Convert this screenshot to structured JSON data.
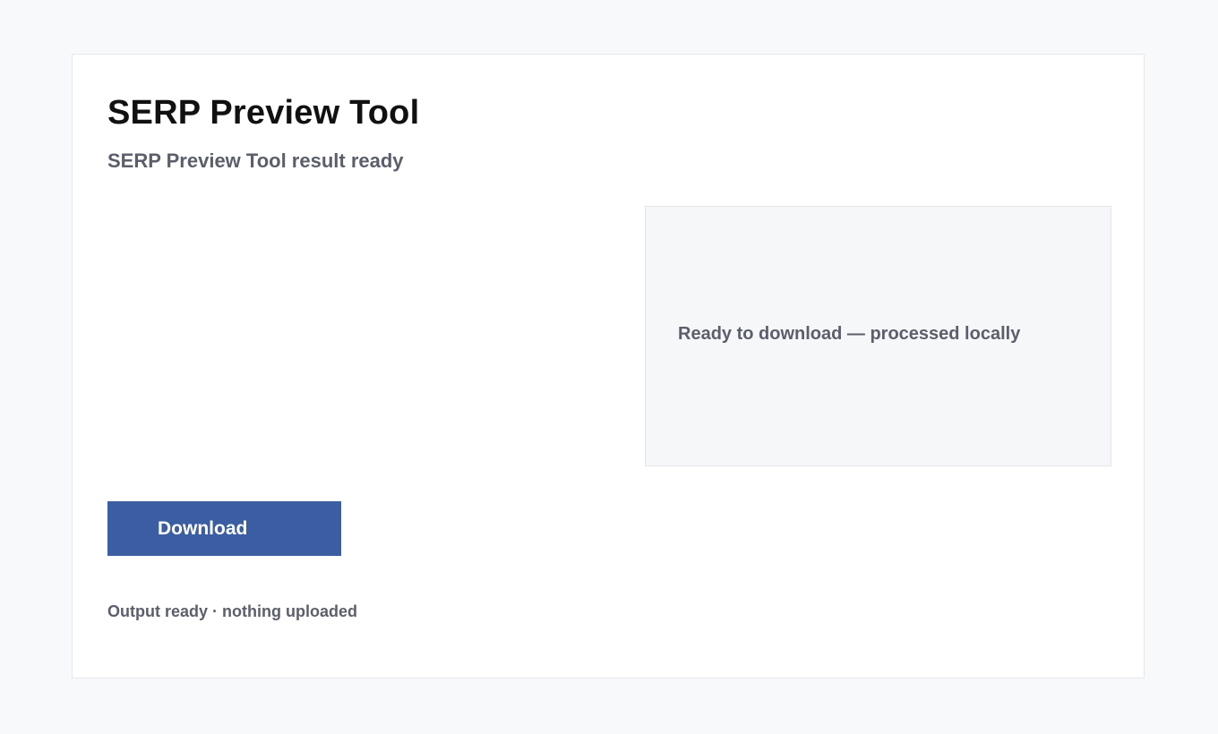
{
  "app": {
    "title": "SERP Preview Tool",
    "subtitle": "SERP Preview Tool result ready"
  },
  "result_panel": {
    "status": "Ready to download — processed locally"
  },
  "actions": {
    "download_label": "Download"
  },
  "footer": {
    "status": "Output ready · nothing uploaded"
  },
  "colors": {
    "page_background": "#f8f9fa",
    "card_background": "#ffffff",
    "panel_background": "#f6f7f8",
    "primary_button": "#3b5ea3",
    "text_primary": "#111111",
    "text_secondary": "#5b5f6b"
  }
}
